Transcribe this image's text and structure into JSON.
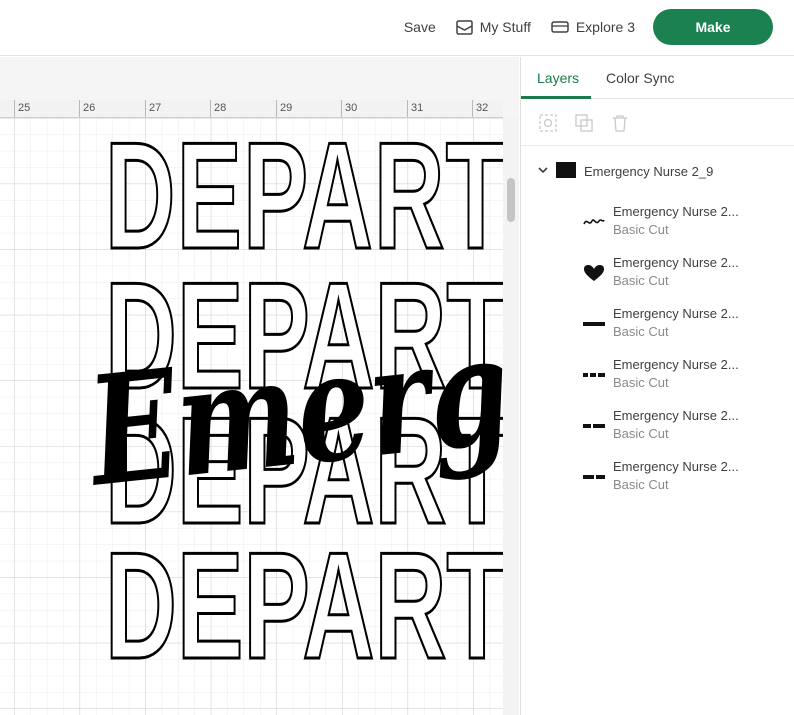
{
  "header": {
    "save_label": "Save",
    "my_stuff_label": "My Stuff",
    "machine_label": "Explore 3",
    "make_label": "Make"
  },
  "ruler": {
    "labels": [
      "25",
      "26",
      "27",
      "28",
      "29",
      "30",
      "31",
      "32"
    ]
  },
  "artwork": {
    "repeated_word": "DEPARTI",
    "script_word": "Emerg"
  },
  "panel": {
    "tabs": [
      {
        "label": "Layers",
        "active": true
      },
      {
        "label": "Color Sync",
        "active": false
      }
    ],
    "tool_icons": [
      "group-icon",
      "duplicate-icon",
      "delete-icon"
    ],
    "group": {
      "name": "Emergency Nurse 2_9",
      "expanded": true
    },
    "layers": [
      {
        "name": "Emergency Nurse 2...",
        "type": "Basic Cut",
        "thumb": "script-thumb"
      },
      {
        "name": "Emergency Nurse 2...",
        "type": "Basic Cut",
        "thumb": "heart-thumb"
      },
      {
        "name": "Emergency Nurse 2...",
        "type": "Basic Cut",
        "thumb": "stripe-thumb"
      },
      {
        "name": "Emergency Nurse 2...",
        "type": "Basic Cut",
        "thumb": "stripe-thumb"
      },
      {
        "name": "Emergency Nurse 2...",
        "type": "Basic Cut",
        "thumb": "stripe-thumb"
      },
      {
        "name": "Emergency Nurse 2...",
        "type": "Basic Cut",
        "thumb": "stripe-thumb"
      }
    ]
  },
  "colors": {
    "accent": "#1b8151",
    "tab_active": "#1b7a4b",
    "artwork": "#000000"
  }
}
